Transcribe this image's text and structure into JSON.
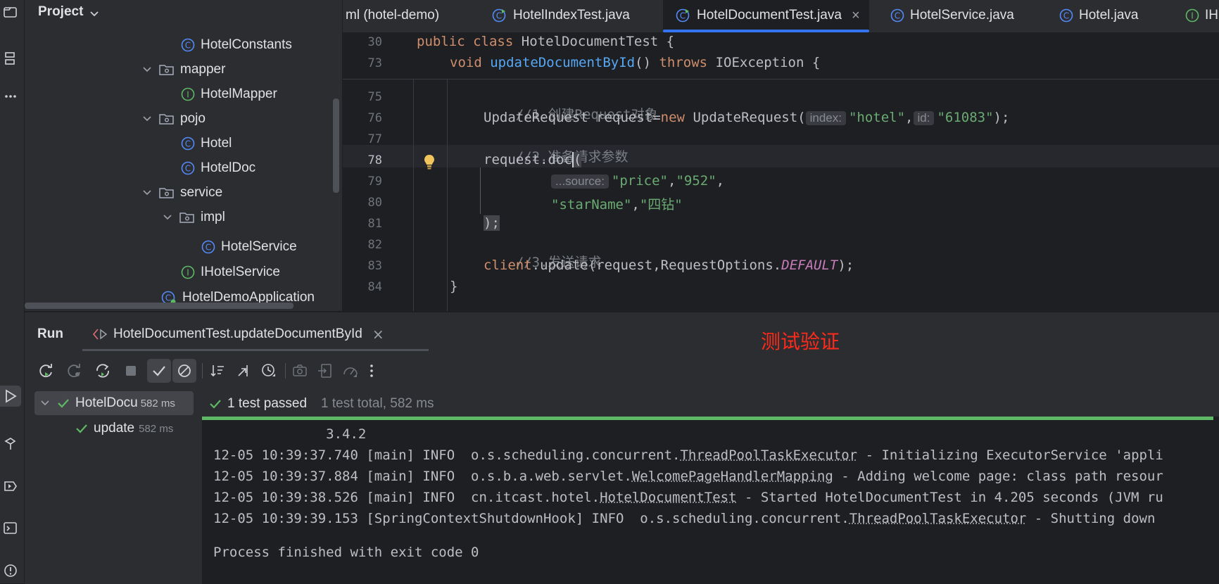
{
  "project": {
    "title": "Project",
    "tree": [
      {
        "label": "HotelConstants",
        "icon": "class-icon"
      },
      {
        "label": "mapper",
        "icon": "folder-icon"
      },
      {
        "label": "HotelMapper",
        "icon": "interface-icon"
      },
      {
        "label": "pojo",
        "icon": "folder-icon"
      },
      {
        "label": "Hotel",
        "icon": "class-icon"
      },
      {
        "label": "HotelDoc",
        "icon": "class-icon"
      },
      {
        "label": "service",
        "icon": "folder-icon"
      },
      {
        "label": "impl",
        "icon": "folder-icon"
      },
      {
        "label": "HotelService",
        "icon": "class-icon"
      },
      {
        "label": "IHotelService",
        "icon": "interface-icon"
      },
      {
        "label": "HotelDemoApplication",
        "icon": "spring-app-icon"
      }
    ]
  },
  "tabs": [
    {
      "label": "ml (hotel-demo)"
    },
    {
      "label": "HotelIndexTest.java"
    },
    {
      "label": "HotelDocumentTest.java",
      "active": true,
      "close": "×"
    },
    {
      "label": "HotelService.java"
    },
    {
      "label": "Hotel.java"
    },
    {
      "label": "IH"
    }
  ],
  "editor": {
    "lines": [
      "30",
      "73",
      "75",
      "76",
      "77",
      "78",
      "79",
      "80",
      "81",
      "82",
      "83",
      "84"
    ],
    "sticky_1": {
      "kw1": "public",
      "kw2": "class",
      "name": "HotelDocumentTest",
      "brace": "{"
    },
    "sticky_2": {
      "kw1": "void",
      "fn": "updateDocumentById",
      "paren": "()",
      "kw2": "throws",
      "exc": "IOException",
      "brace": "{"
    },
    "c75": "//1.创建Request对象",
    "l76": {
      "type": "UpdateRequest request=",
      "kw": "new",
      "ctor": " UpdateRequest(",
      "hint_index": "index:",
      "s1": "\"hotel\"",
      "comma": ",",
      "hint_id": "id:",
      "s2": "\"61083\"",
      "end": ");"
    },
    "c77": "//2.准备请求参数",
    "l78": {
      "obj": "request.",
      "method": "doc",
      "paren": "("
    },
    "l79": {
      "hint_source": "...source:",
      "s1": "\"price\"",
      "c1": ",",
      "s2": "\"952\"",
      "c2": ","
    },
    "l80": {
      "s1": "\"starName\"",
      "c1": ",",
      "s2": "\"四钻\""
    },
    "l81": ");",
    "c82": "//3.发送请求",
    "l83": {
      "obj": "client",
      "rest": ".update(request,RequestOptions.",
      "cst": "DEFAULT",
      "end": ");"
    },
    "l84": "}"
  },
  "run": {
    "title": "Run",
    "config_tab": "HotelDocumentTest.updateDocumentById",
    "close": "×",
    "annotation": "测试验证",
    "annotation_color": "#ff2a1a",
    "tree": [
      {
        "label": "HotelDocu",
        "time": "582 ms"
      },
      {
        "label": "update",
        "time": "582 ms"
      }
    ],
    "status": "1 test passed",
    "summary": "1 test total, 582 ms",
    "console": [
      "              3.4.2",
      {
        "pre": "12-05 10:39:37.740 [main] INFO  o.s.scheduling.concurrent.",
        "link": "ThreadPoolTaskExecutor",
        "post": " - Initializing ExecutorService 'appli"
      },
      {
        "pre": "12-05 10:39:37.884 [main] INFO  o.s.b.a.web.servlet.",
        "link": "WelcomePageHandlerMapping",
        "post": " - Adding welcome page: class path resour"
      },
      {
        "pre": "12-05 10:39:38.526 [main] INFO  cn.itcast.hotel.",
        "link": "HotelDocumentTest",
        "post": " - Started HotelDocumentTest in 4.205 seconds (JVM ru"
      },
      {
        "pre": "12-05 10:39:39.153 [SpringContextShutdownHook] INFO  o.s.scheduling.concurrent.",
        "link": "ThreadPoolTaskExecutor",
        "post": " - Shutting down"
      },
      "",
      "Process finished with exit code 0"
    ]
  },
  "colors": {
    "accent": "#3574f0",
    "pass": "#5fb865",
    "bg": "#1e1f22",
    "panel": "#2b2d30"
  }
}
